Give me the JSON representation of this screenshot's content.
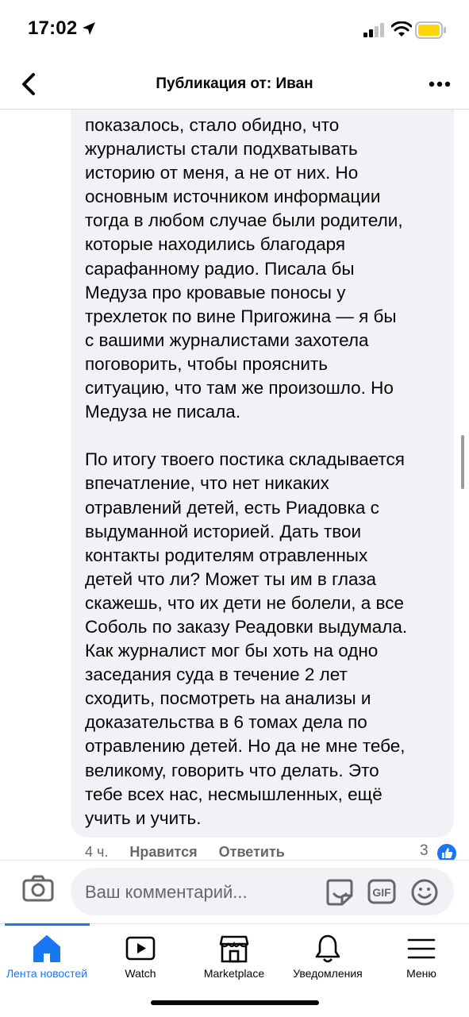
{
  "status_bar": {
    "time": "17:02"
  },
  "header": {
    "title": "Публикация от: Иван"
  },
  "comment": {
    "text": "показалось, стало обидно, что\nжурналисты стали подхватывать\nисторию от меня, а не от них. Но\nосновным источником информации\nтогда в любом случае были родители,\nкоторые находились благодаря\nсарафанному радио. Писала бы\nМедуза про кровавые поносы у\nтрехлеток по вине Пригожина — я бы\nс вашими журналистами захотела\nпоговорить, чтобы прояснить\nситуацию, что там же произошло. Но\nМедуза не писала.\n\nПо итогу твоего постика складывается\nвпечатление, что нет никаких\nотравлений детей, есть Риадовка с\nвыдуманной историей. Дать твои\nконтакты родителям отравленных\nдетей что ли? Может ты им в глаза\nскажешь, что их дети не болели, а все\nСоболь по заказу Реадовки выдумала.\nКак журналист мог бы хоть на одно\nзаседания суда в течение 2 лет\nсходить, посмотреть на анализы и\nдоказательства в 6 томах дела по\nотравлению детей. Но да не мне тебе,\nвеликому, говорить что делать. Это\nтебе всех нас, несмышленных, ещё\nучить и учить.",
    "time_ago": "4 ч.",
    "like_label": "Нравится",
    "reply_label": "Ответить",
    "reaction_count": "3"
  },
  "composer": {
    "placeholder": "Ваш комментарий...",
    "gif_label": "GIF"
  },
  "tabbar": {
    "items": [
      {
        "label": "Лента новостей",
        "icon": "home-icon",
        "active": true
      },
      {
        "label": "Watch",
        "icon": "watch-icon",
        "active": false
      },
      {
        "label": "Marketplace",
        "icon": "marketplace-icon",
        "active": false
      },
      {
        "label": "Уведомления",
        "icon": "bell-icon",
        "active": false
      },
      {
        "label": "Меню",
        "icon": "menu-icon",
        "active": false
      }
    ]
  },
  "colors": {
    "accent": "#1877f2",
    "bubble": "#f0f2f5",
    "secondary_text": "#65676b"
  }
}
